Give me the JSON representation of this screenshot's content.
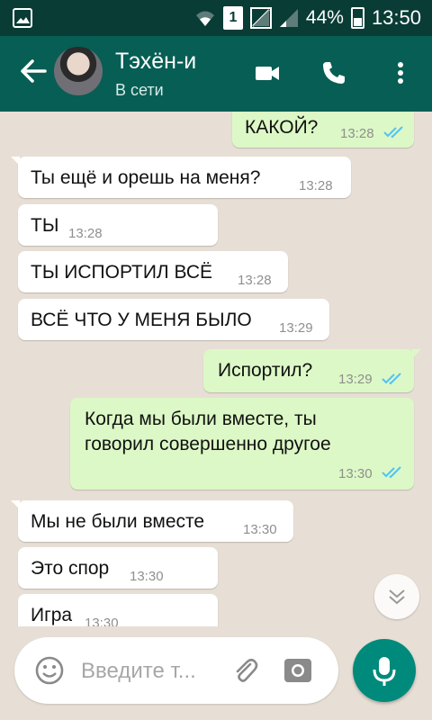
{
  "status_bar": {
    "sim_label": "1",
    "battery": "44%",
    "time": "13:50"
  },
  "header": {
    "contact_name": "Тэхён-и",
    "contact_status": "В сети"
  },
  "messages": [
    {
      "direction": "out",
      "text": "КАКОЙ?",
      "time": "13:28"
    },
    {
      "direction": "in",
      "text": "Ты ещё и орешь на меня?",
      "time": "13:28"
    },
    {
      "direction": "in",
      "text": "ТЫ",
      "time": "13:28"
    },
    {
      "direction": "in",
      "text": "ТЫ ИСПОРТИЛ ВСЁ",
      "time": "13:28"
    },
    {
      "direction": "in",
      "text": "ВСЁ ЧТО У МЕНЯ БЫЛО",
      "time": "13:29"
    },
    {
      "direction": "out",
      "text": "Испортил?",
      "time": "13:29"
    },
    {
      "direction": "out",
      "text_line1": "Когда мы были вместе, ты",
      "text_line2": "говорил совершенно другое",
      "time": "13:30"
    },
    {
      "direction": "in",
      "text": "Мы не были вместе",
      "time": "13:30"
    },
    {
      "direction": "in",
      "text": "Это спор",
      "time": "13:30"
    },
    {
      "direction": "in",
      "text": "Игра",
      "time": "13:30"
    }
  ],
  "input": {
    "placeholder": "Введите т..."
  },
  "colors": {
    "header": "#075e54",
    "status_bar": "#0a3c36",
    "outgoing_bubble": "#dcf8c6",
    "incoming_bubble": "#ffffff",
    "read_ticks": "#4fc3f7",
    "mic_button": "#008a7c"
  },
  "icons": [
    "gallery-icon",
    "wifi-icon",
    "signal-icon",
    "battery-icon",
    "back-arrow-icon",
    "video-call-icon",
    "phone-icon",
    "more-options-icon",
    "double-check-icon",
    "chevron-down-icon",
    "emoji-icon",
    "attach-icon",
    "camera-icon",
    "mic-icon"
  ]
}
